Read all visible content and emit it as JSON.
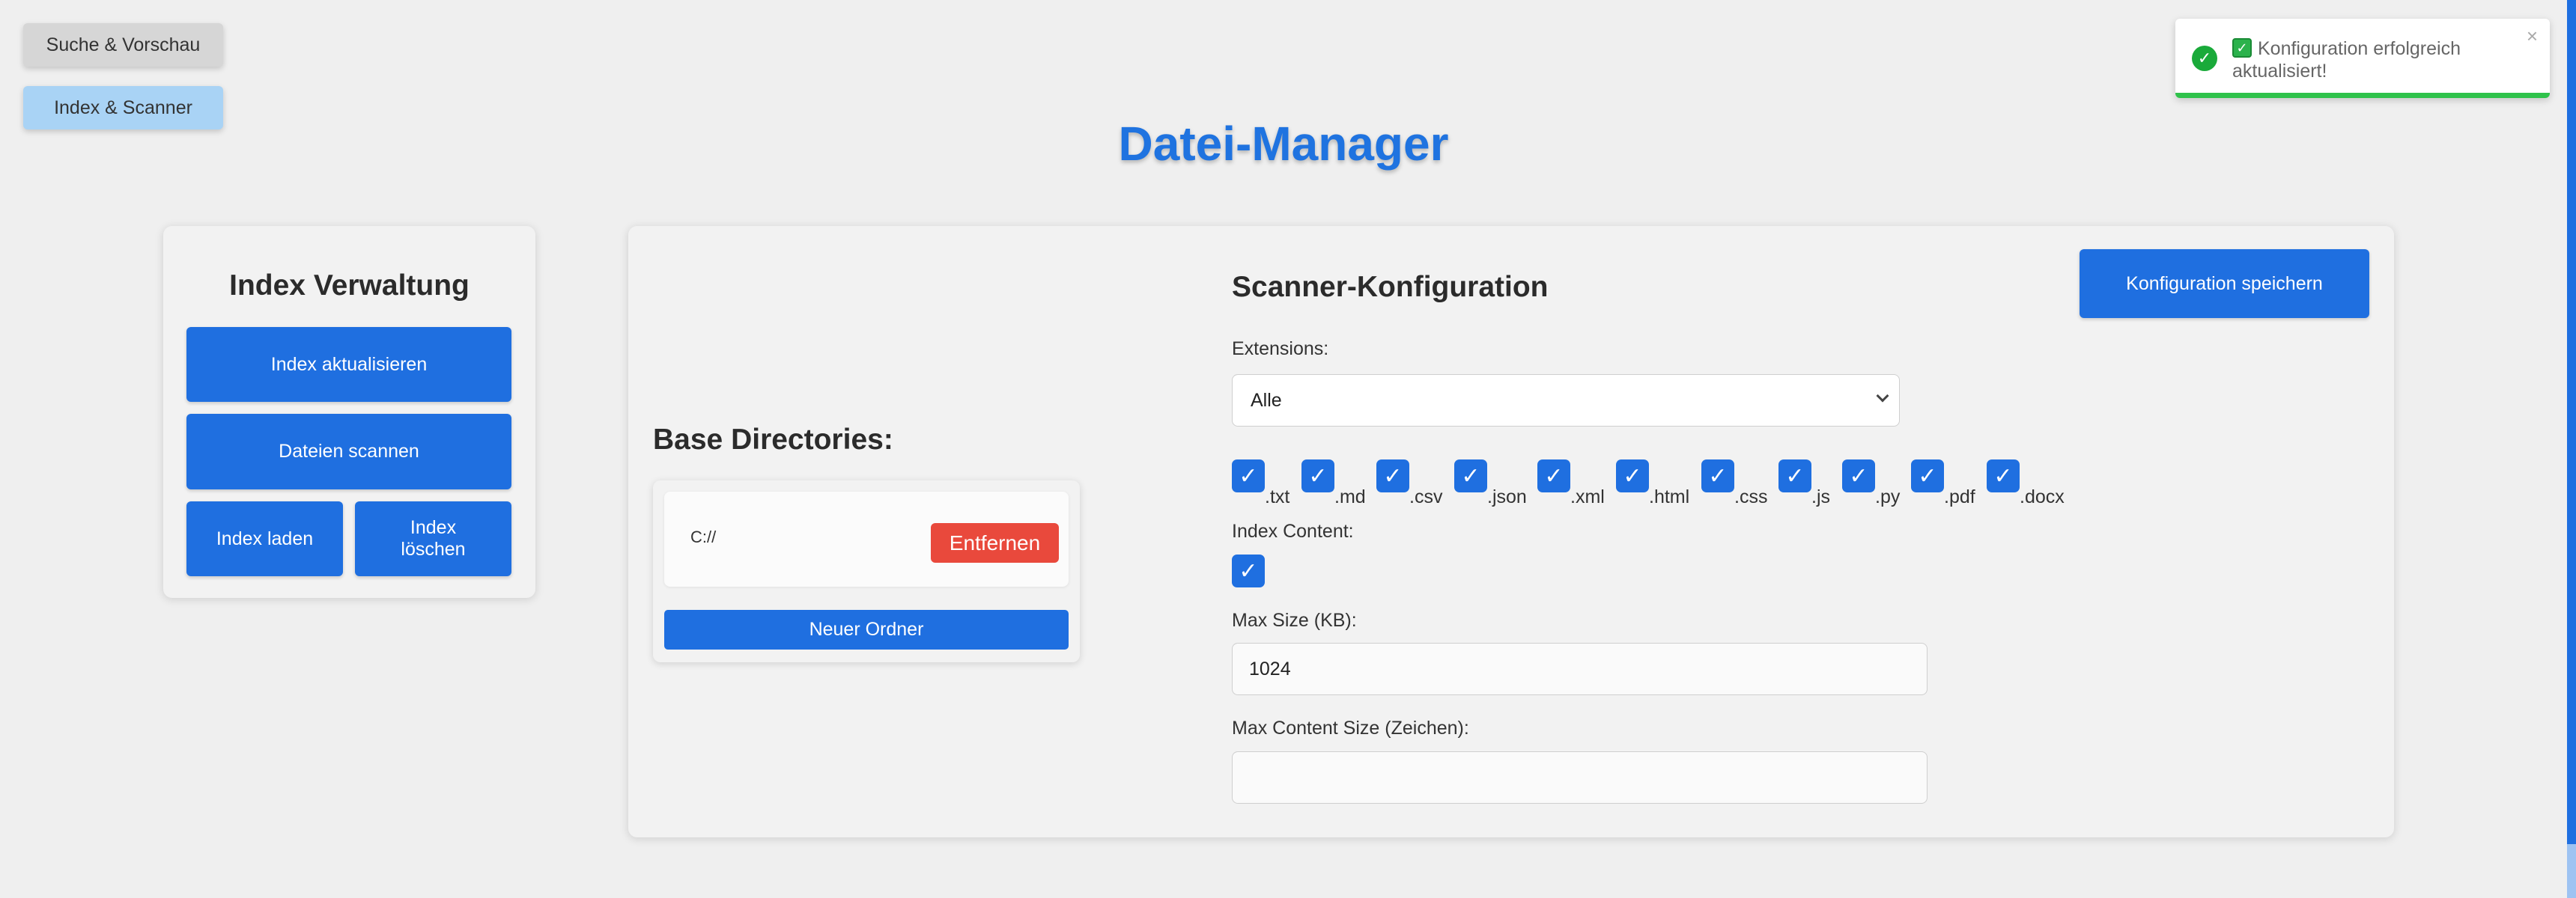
{
  "nav": {
    "search_preview": "Suche & Vorschau",
    "index_scanner": "Index & Scanner"
  },
  "app_title": "Datei-Manager",
  "index_panel": {
    "title": "Index Verwaltung",
    "update": "Index aktualisieren",
    "scan": "Dateien scannen",
    "load": "Index laden",
    "delete": "Index löschen"
  },
  "base_dirs": {
    "title": "Base Directories:",
    "items": [
      {
        "path": "C://",
        "remove_label": "Entfernen"
      }
    ],
    "new_folder": "Neuer Ordner"
  },
  "scanner": {
    "title": "Scanner-Konfiguration",
    "save_button": "Konfiguration speichern",
    "extensions_label": "Extensions:",
    "extensions_selected": "Alle",
    "extensions": [
      {
        "label": ".txt",
        "checked": true
      },
      {
        "label": ".md",
        "checked": true
      },
      {
        "label": ".csv",
        "checked": true
      },
      {
        "label": ".json",
        "checked": true
      },
      {
        "label": ".xml",
        "checked": true
      },
      {
        "label": ".html",
        "checked": true
      },
      {
        "label": ".css",
        "checked": true
      },
      {
        "label": ".js",
        "checked": true
      },
      {
        "label": ".py",
        "checked": true
      },
      {
        "label": ".pdf",
        "checked": true
      },
      {
        "label": ".docx",
        "checked": true
      }
    ],
    "index_content_label": "Index Content:",
    "index_content_checked": true,
    "max_size_label": "Max Size (KB):",
    "max_size_value": "1024",
    "max_content_label": "Max Content Size (Zeichen):",
    "max_content_value": ""
  },
  "toast": {
    "message": "Konfiguration erfolgreich aktualisiert!",
    "close": "×",
    "status_icon": "check-circle-icon",
    "status_color": "#1aaa3a"
  },
  "colors": {
    "accent": "#1f6fe0",
    "danger": "#e9493c",
    "title": "#1f73e0"
  },
  "check_glyph": "✓"
}
